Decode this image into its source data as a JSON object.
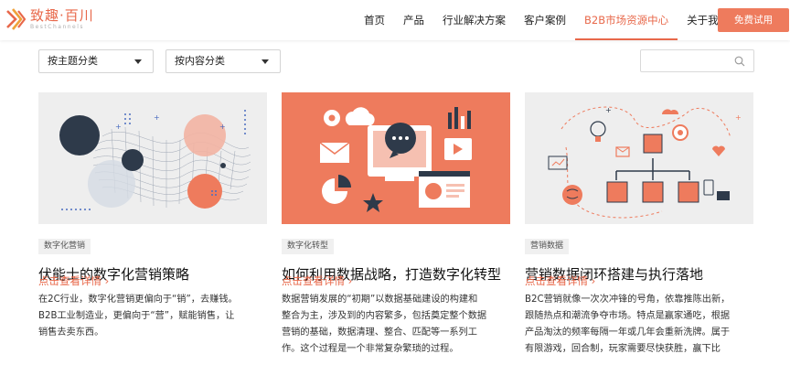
{
  "header": {
    "logo": {
      "name": "致趣·百川",
      "subtitle": "BestChannels"
    },
    "nav": [
      {
        "label": "首页",
        "active": false
      },
      {
        "label": "产品",
        "active": false
      },
      {
        "label": "行业解决方案",
        "active": false
      },
      {
        "label": "客户案例",
        "active": false
      },
      {
        "label": "B2B市场资源中心",
        "active": true
      },
      {
        "label": "关于我们",
        "active": false
      }
    ],
    "cta_label": "免费试用"
  },
  "filters": {
    "topic": {
      "selected": "按主题分类"
    },
    "content": {
      "selected": "按内容分类"
    }
  },
  "search": {
    "value": "",
    "placeholder": ""
  },
  "articles": [
    {
      "tag": "数字化营销",
      "title": "伏能士的数字化营销策略",
      "desc_lines": [
        "在2C行业，数字化营销更偏向于“销”，去赚钱。",
        "B2B工业制造业，更偏向于“营”，赋能销售，让",
        "销售去卖东西。"
      ],
      "more": "点击查看详情",
      "image_bg": "#eeeeee"
    },
    {
      "tag": "数字化转型",
      "title": "如何利用数据战略，打造数字化转型",
      "desc_lines": [
        "数据营销发展的“初期”以数据基础建设的构建和",
        "整合为主，涉及到的内容繁多，包括奠定整个数据",
        "营销的基础，数据清理、整合、匹配等一系列工",
        "作。这个过程是一个非常复杂繁琐的过程。"
      ],
      "more": "点击查看详情",
      "image_bg": "#ee7b5d"
    },
    {
      "tag": "营销数据",
      "title": "营销数据闭环搭建与执行落地",
      "desc_lines": [
        "B2C营销就像一次次冲锋的号角，依靠推陈出新，",
        "跟随热点和潮流争夺市场。特点是赢家通吃，根据",
        "产品淘汰的频率每隔一年或几年会重新洗牌。属于",
        "有限游戏，回合制，玩家需要尽快获胜，赢下比"
      ],
      "more": "点击查看详情",
      "image_bg": "#eeeeee"
    }
  ],
  "colors": {
    "accent": "#e8684a",
    "cta": "#ee7b5d",
    "dark": "#2e3a4a"
  }
}
